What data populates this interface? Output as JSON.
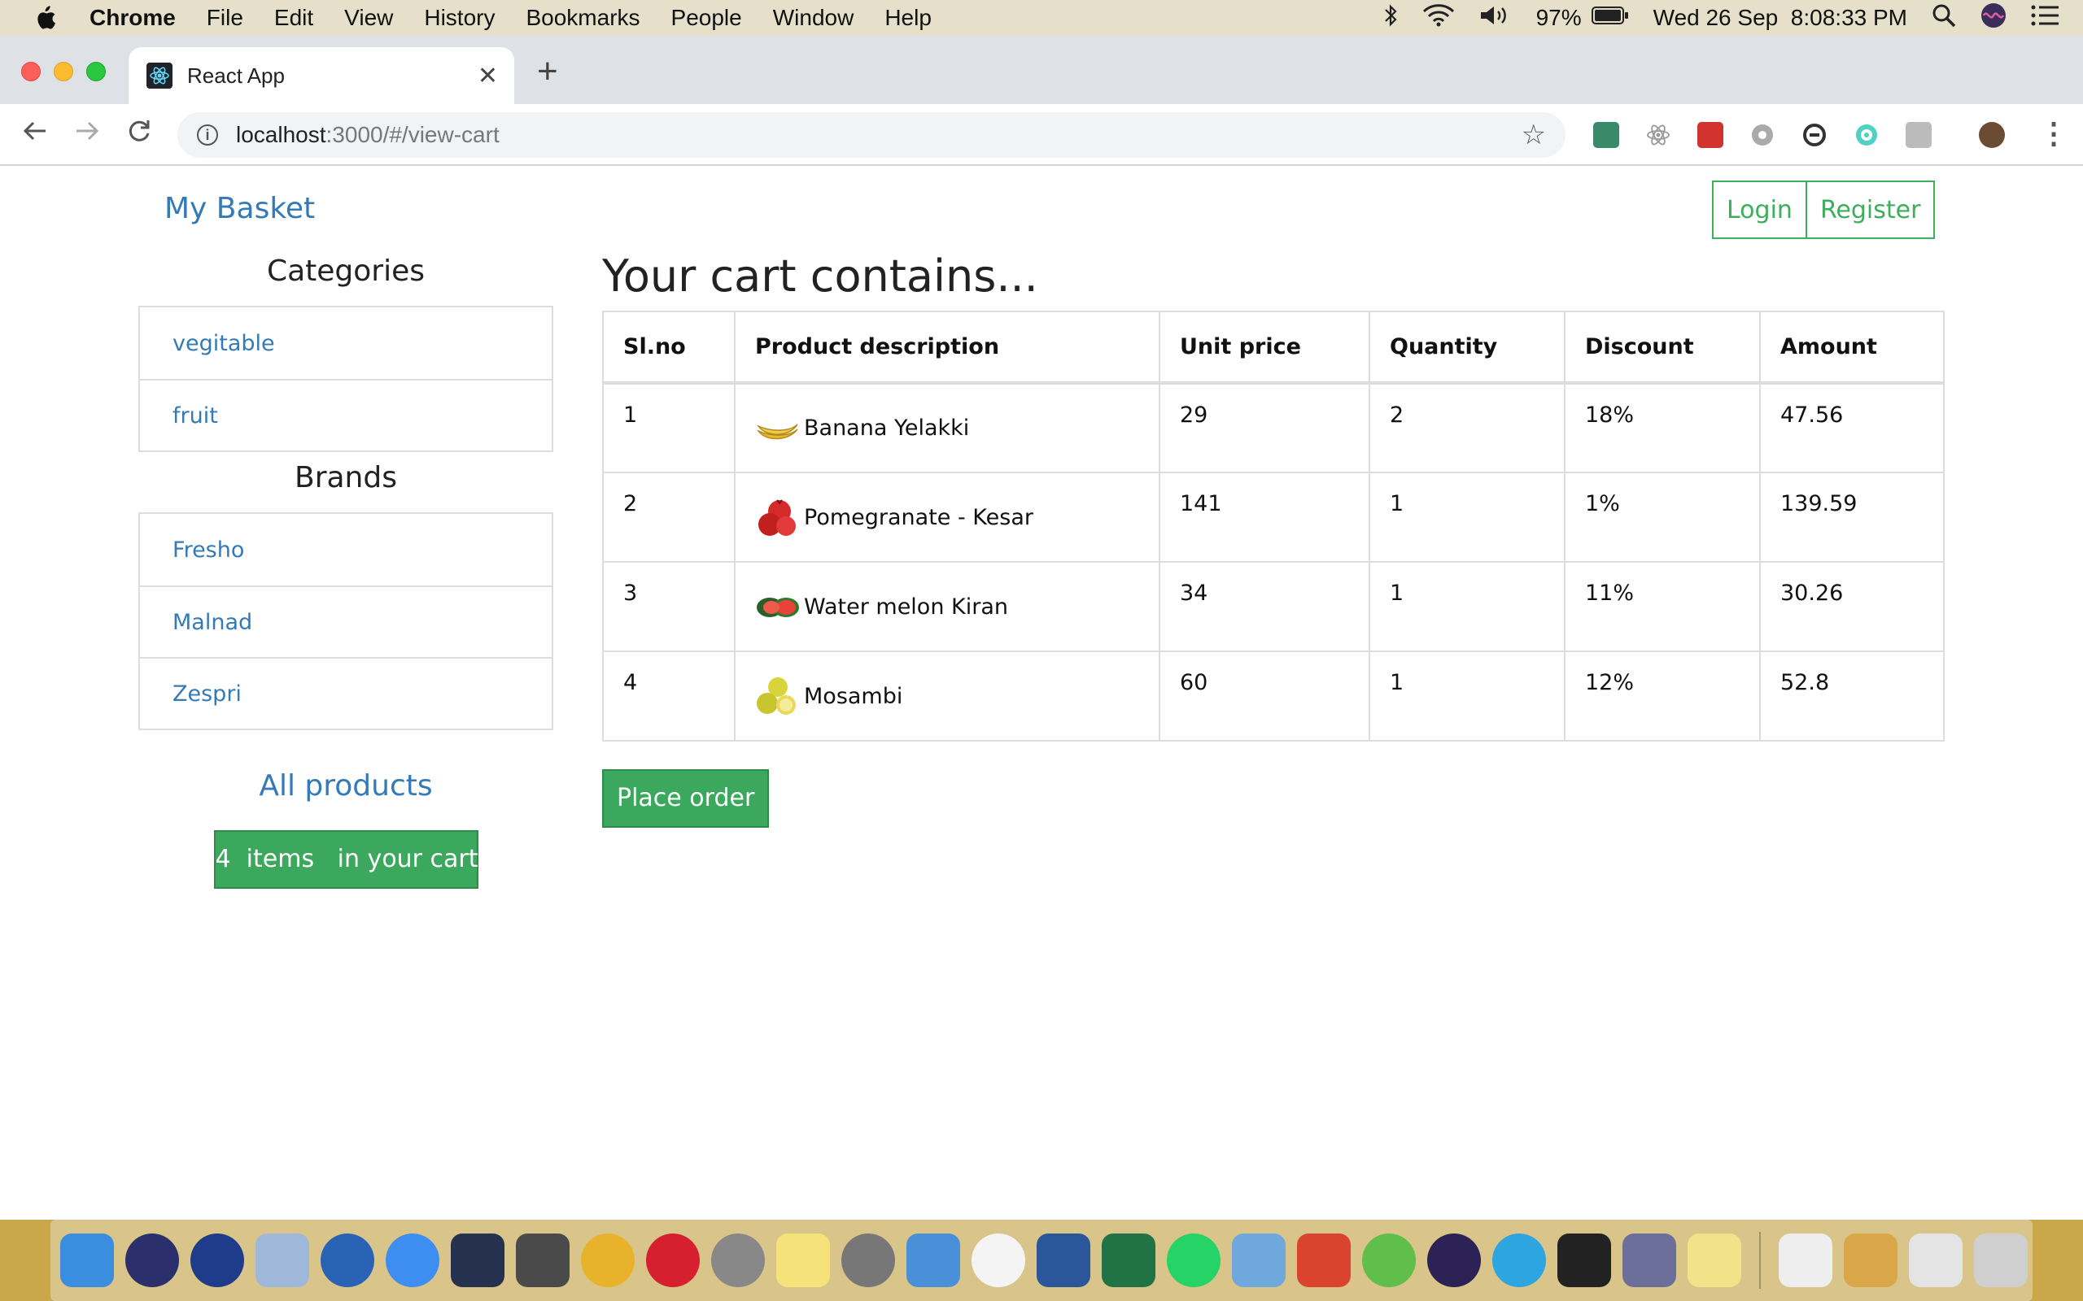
{
  "menubar": {
    "app_name": "Chrome",
    "menus": [
      "File",
      "Edit",
      "View",
      "History",
      "Bookmarks",
      "People",
      "Window",
      "Help"
    ],
    "battery": "97%",
    "datetime": "Wed 26 Sep  8:08:33 PM"
  },
  "browser": {
    "tab_title": "React App",
    "url_host": "localhost",
    "url_path": ":3000/#/view-cart"
  },
  "page": {
    "brand": "My Basket",
    "login_label": "Login",
    "register_label": "Register",
    "categories_heading": "Categories",
    "categories": [
      "vegitable",
      "fruit"
    ],
    "brands_heading": "Brands",
    "brands": [
      "Fresho",
      "Malnad",
      "Zespri"
    ],
    "all_products_label": "All products",
    "cart_count_text": "4  items   in your cart.",
    "cart_heading": "Your cart contains...",
    "table_headers": [
      "Sl.no",
      "Product description",
      "Unit price",
      "Quantity",
      "Discount",
      "Amount"
    ],
    "rows": [
      {
        "slno": "1",
        "product": "Banana Yelakki",
        "unit_price": "29",
        "quantity": "2",
        "discount": "18%",
        "amount": "47.56"
      },
      {
        "slno": "2",
        "product": "Pomegranate - Kesar",
        "unit_price": "141",
        "quantity": "1",
        "discount": "1%",
        "amount": "139.59"
      },
      {
        "slno": "3",
        "product": "Water melon Kiran",
        "unit_price": "34",
        "quantity": "1",
        "discount": "11%",
        "amount": "30.26"
      },
      {
        "slno": "4",
        "product": "Mosambi",
        "unit_price": "60",
        "quantity": "1",
        "discount": "12%",
        "amount": "52.8"
      }
    ],
    "place_order_label": "Place order"
  },
  "colors": {
    "link_blue": "#337ab7",
    "success_green": "#3ca85d"
  }
}
